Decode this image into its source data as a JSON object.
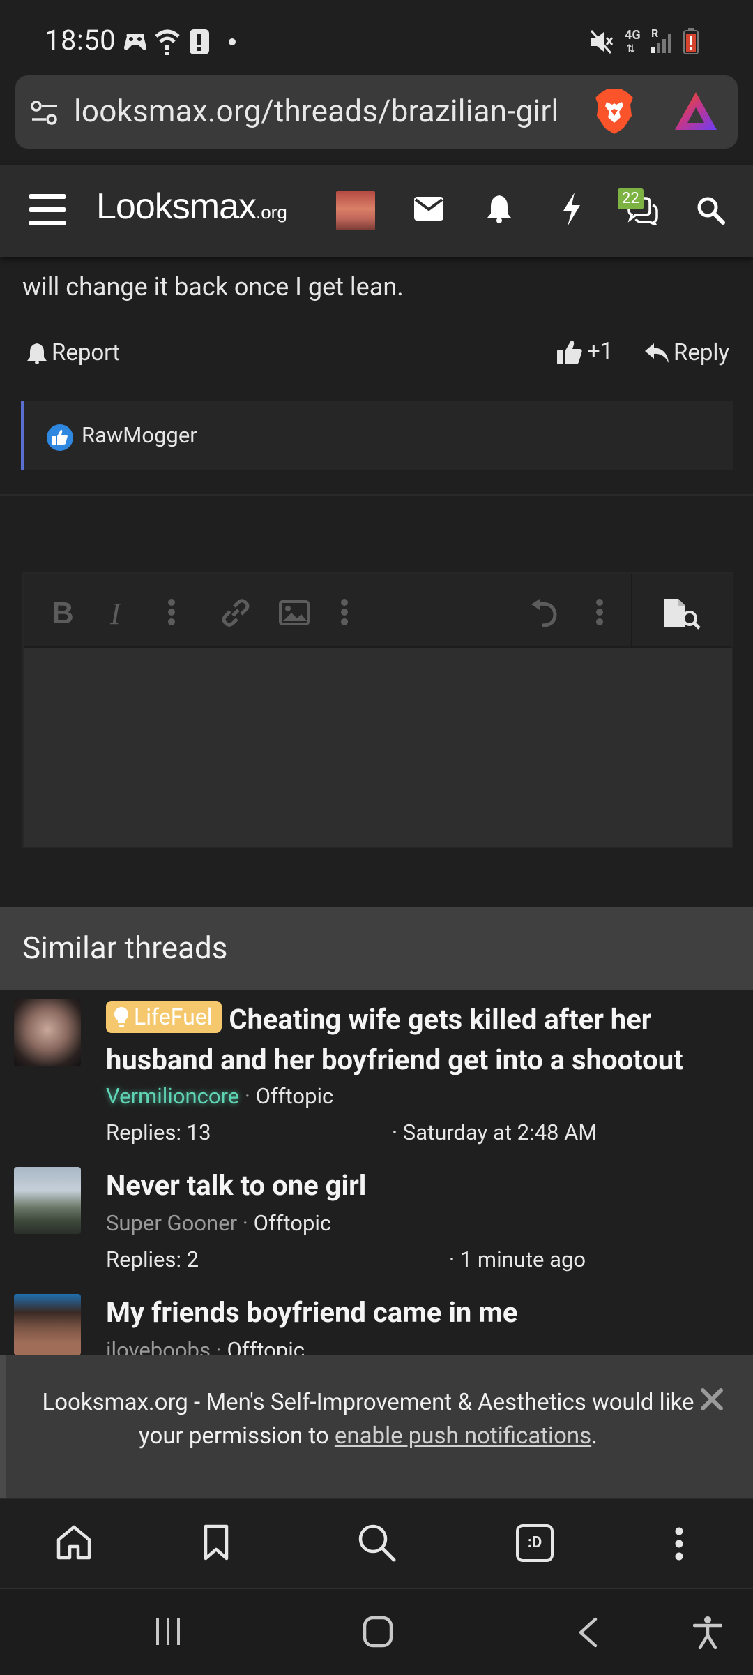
{
  "status_bar": {
    "time": "18:50",
    "network": "4G",
    "carrier_indicator": "R"
  },
  "browser": {
    "url": "looksmax.org/threads/brazilian-girl"
  },
  "site_header": {
    "logo_main": "Looksmax",
    "logo_suffix": ".org",
    "chat_badge": "22"
  },
  "post": {
    "text": "will change it back once I get lean.",
    "report_label": "Report",
    "like_label": "+1",
    "reply_label": "Reply",
    "reaction_user": "RawMogger"
  },
  "similar_threads": {
    "title": "Similar threads",
    "items": [
      {
        "prefix": "LifeFuel",
        "title": "Cheating wife gets killed after her husband and her boyfriend get into a shootout",
        "author": "Vermilioncore",
        "forum": "Offtopic",
        "replies": "Replies: 13",
        "date": "Saturday at 2:48 AM"
      },
      {
        "prefix": "",
        "title": "Never talk to one girl",
        "author": "Super Gooner",
        "forum": "Offtopic",
        "replies": "Replies: 2",
        "date": "1 minute ago"
      },
      {
        "prefix": "",
        "title": "My friends boyfriend came in me",
        "author": "iloveboobs",
        "forum": "Offtopic",
        "replies": "",
        "date": ""
      }
    ]
  },
  "push_banner": {
    "text_before": "Looksmax.org - Men's Self-Improvement & Aesthetics would like your permission to ",
    "link": "enable push notifications",
    "text_after": "."
  },
  "bottom_bar": {
    "tabs_label": ":D"
  },
  "colors": {
    "background": "#1f1f1f",
    "header": "#2c2c2d",
    "accent_blue": "#5a6fd0",
    "badge_green": "#7cb342",
    "prefix_yellow": "#f6c86e",
    "author_teal": "#5fd4b4"
  }
}
